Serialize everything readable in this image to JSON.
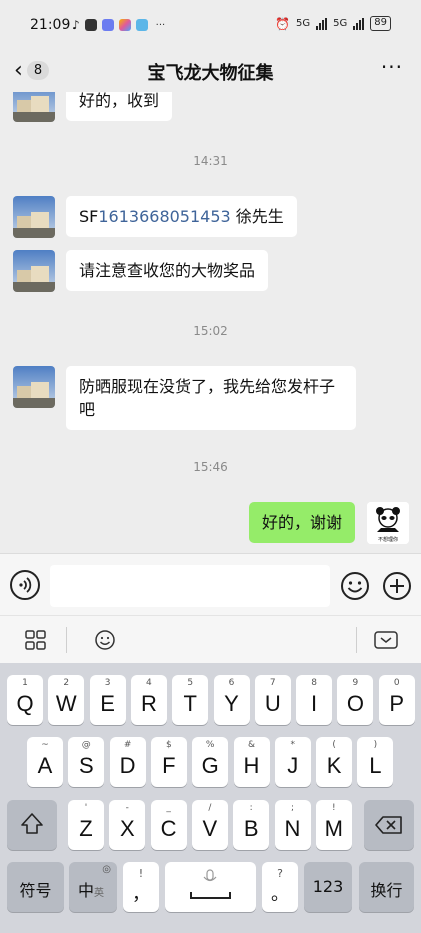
{
  "status_bar": {
    "time": "21:09",
    "dots": "···",
    "net1": "5G",
    "net2": "5G",
    "battery": "89"
  },
  "header": {
    "back_count": "8",
    "title": "宝飞龙大物征集",
    "more": "···"
  },
  "messages": [
    {
      "side": "left",
      "text": "好的，收到"
    },
    {
      "type": "time",
      "text": "14:31"
    },
    {
      "side": "left",
      "prefix": "SF",
      "link": "1613668051453",
      "suffix": " 徐先生"
    },
    {
      "side": "left",
      "text": "请注意查收您的大物奖品"
    },
    {
      "type": "time",
      "text": "15:02"
    },
    {
      "side": "left",
      "text": "防晒服现在没货了，我先给您发杆子吧"
    },
    {
      "type": "time",
      "text": "15:46"
    },
    {
      "side": "right",
      "text": "好的，谢谢"
    }
  ],
  "sticker": {
    "text": "不想理你"
  },
  "keyboard": {
    "row1": [
      {
        "sub": "1",
        "key": "Q"
      },
      {
        "sub": "2",
        "key": "W"
      },
      {
        "sub": "3",
        "key": "E"
      },
      {
        "sub": "4",
        "key": "R"
      },
      {
        "sub": "5",
        "key": "T"
      },
      {
        "sub": "6",
        "key": "Y"
      },
      {
        "sub": "7",
        "key": "U"
      },
      {
        "sub": "8",
        "key": "I"
      },
      {
        "sub": "9",
        "key": "O"
      },
      {
        "sub": "0",
        "key": "P"
      }
    ],
    "row2": [
      {
        "sub": "~",
        "key": "A"
      },
      {
        "sub": "@",
        "key": "S"
      },
      {
        "sub": "#",
        "key": "D"
      },
      {
        "sub": "$",
        "key": "F"
      },
      {
        "sub": "%",
        "key": "G"
      },
      {
        "sub": "&",
        "key": "H"
      },
      {
        "sub": "*",
        "key": "J"
      },
      {
        "sub": "(",
        "key": "K"
      },
      {
        "sub": ")",
        "key": "L"
      }
    ],
    "row3": [
      {
        "sub": "'",
        "key": "Z"
      },
      {
        "sub": "-",
        "key": "X"
      },
      {
        "sub": "_",
        "key": "C"
      },
      {
        "sub": "/",
        "key": "V"
      },
      {
        "sub": ":",
        "key": "B"
      },
      {
        "sub": ";",
        "key": "N"
      },
      {
        "sub": "!",
        "key": "M"
      }
    ],
    "symbols": "符号",
    "lang": "中",
    "lang_sub": "英",
    "comma": "，",
    "comma_sub": "!",
    "period": "。",
    "period_sub": "?",
    "num": "123",
    "enter": "换行"
  },
  "colors": {
    "bg": "#ededed",
    "bubble_left": "#ffffff",
    "bubble_right": "#95ec69",
    "link": "#3f6499"
  }
}
